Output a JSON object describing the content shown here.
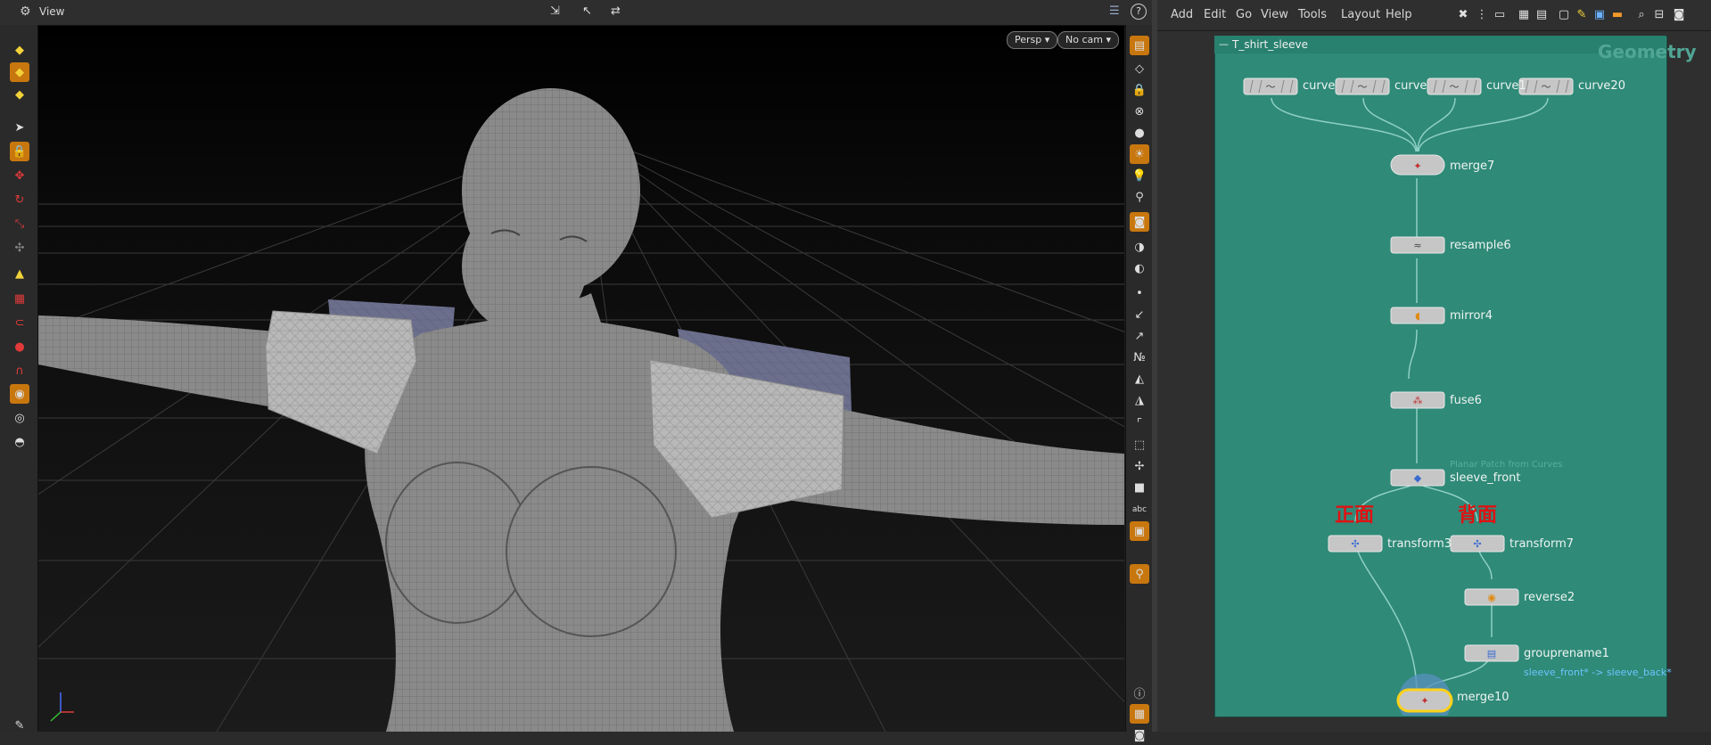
{
  "viewport": {
    "title": "View",
    "persp_label": "Persp",
    "cam_label": "No cam"
  },
  "network": {
    "menu": [
      "Add",
      "Edit",
      "Go",
      "View",
      "Tools",
      "Layout",
      "Help"
    ],
    "title": "T_shirt_sleeve",
    "context_label": "Geometry",
    "nodes": {
      "curve1": "curve",
      "curve2": "curve",
      "curve3": "curve1",
      "curve4": "curve20",
      "merge7": "merge7",
      "resample6": "resample6",
      "mirror4": "mirror4",
      "fuse6": "fuse6",
      "sleeve_front": "sleeve_front",
      "sleeve_front_comment": "Planar Patch from Curves",
      "transform3": "transform3",
      "transform7": "transform7",
      "reverse2": "reverse2",
      "grouprename1": "grouprename1",
      "grouprename1_comment": "sleeve_front* -> sleeve_back*",
      "merge10": "merge10"
    },
    "notes": {
      "front": "正面",
      "back": "背面"
    },
    "colors": {
      "canvas": "#2f8a78",
      "selected": "#ffd21a",
      "note": "#e01212",
      "tool_active": "#c8770e"
    }
  }
}
